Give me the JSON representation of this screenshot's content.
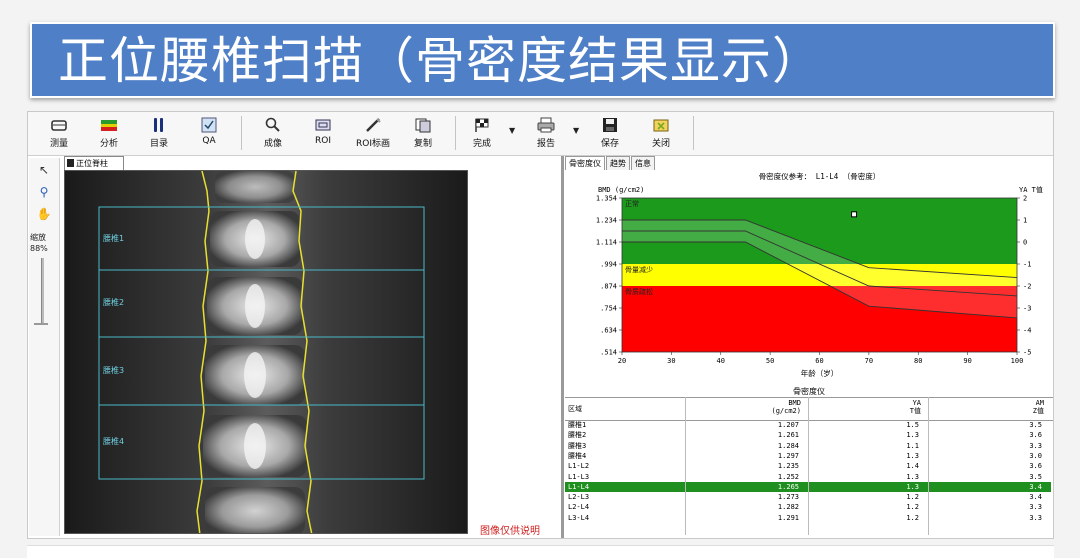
{
  "banner": {
    "title": "正位腰椎扫描（骨密度结果显示）"
  },
  "toolbar": {
    "buttons": [
      {
        "label": "测量",
        "icon": "measure-icon"
      },
      {
        "label": "分析",
        "icon": "analyze-icon"
      },
      {
        "label": "目录",
        "icon": "catalog-icon"
      },
      {
        "label": "QA",
        "icon": "qa-icon"
      },
      {
        "label": "成像",
        "icon": "imaging-icon"
      },
      {
        "label": "ROI",
        "icon": "roi-icon"
      },
      {
        "label": "ROI标画",
        "icon": "roi-draw-icon"
      },
      {
        "label": "复制",
        "icon": "copy-icon"
      },
      {
        "label": "完成",
        "icon": "finish-flag-icon"
      },
      {
        "label": "报告",
        "icon": "printer-icon"
      },
      {
        "label": "保存",
        "icon": "save-icon"
      },
      {
        "label": "关闭",
        "icon": "close-folder-icon"
      }
    ]
  },
  "left_tools": {
    "zoom_label": "缩放",
    "zoom_value": "88%"
  },
  "image_panel": {
    "tab": "正位脊柱",
    "vertebra_labels": [
      "腰椎1",
      "腰椎2",
      "腰椎3",
      "腰椎4"
    ],
    "caption": "图像仅供说明"
  },
  "right_panel": {
    "tabs": [
      "骨密度仪",
      "趋势",
      "信息"
    ],
    "table_title": "骨密度仪"
  },
  "chart_data": {
    "type": "line",
    "title": "骨密度仪参考： L1-L4 （骨密度）",
    "ylabel": "BMD (g/cm2)",
    "y2label": "YA T值",
    "xlabel": "年龄（岁）",
    "xlim": [
      20,
      100
    ],
    "ylim": [
      0.514,
      1.354
    ],
    "x_ticks": [
      "20",
      "30",
      "40",
      "50",
      "60",
      "70",
      "80",
      "90",
      "100"
    ],
    "y_ticks": [
      "1.354",
      "1.234",
      "1.114",
      ".994",
      ".874",
      ".754",
      ".634",
      ".514"
    ],
    "y2_ticks": [
      "2",
      "1",
      "0",
      "-1",
      "-2",
      "-3",
      "-4",
      "-5"
    ],
    "zones": [
      {
        "name": "正常",
        "from": 0.994,
        "to": 1.354,
        "color": "#1c9a1c"
      },
      {
        "name": "骨量减少",
        "from": 0.874,
        "to": 0.994,
        "color": "#ffff00"
      },
      {
        "name": "骨质疏松",
        "from": 0.514,
        "to": 0.874,
        "color": "#ff0000"
      }
    ],
    "series": [
      {
        "x": [
          20,
          45,
          70,
          100
        ],
        "values": [
          1.234,
          1.234,
          0.974,
          0.92
        ]
      },
      {
        "x": [
          20,
          45,
          70,
          100
        ],
        "values": [
          1.174,
          1.174,
          0.874,
          0.82
        ]
      },
      {
        "x": [
          20,
          45,
          70,
          100
        ],
        "values": [
          1.114,
          1.114,
          0.764,
          0.7
        ]
      }
    ],
    "point": {
      "x": 67,
      "y": 1.265
    }
  },
  "table": {
    "headers": {
      "region": "区域",
      "bmd": [
        "BMD",
        "(g/cm2)"
      ],
      "ya": [
        "YA",
        "T值"
      ],
      "am": [
        "AM",
        "Z值"
      ]
    },
    "rows": [
      {
        "region": "腰椎1",
        "bmd": "1.207",
        "t": "1.5",
        "z": "3.5"
      },
      {
        "region": "腰椎2",
        "bmd": "1.261",
        "t": "1.3",
        "z": "3.6"
      },
      {
        "region": "腰椎3",
        "bmd": "1.284",
        "t": "1.1",
        "z": "3.3"
      },
      {
        "region": "腰椎4",
        "bmd": "1.297",
        "t": "1.3",
        "z": "3.0"
      },
      {
        "region": "L1-L2",
        "bmd": "1.235",
        "t": "1.4",
        "z": "3.6"
      },
      {
        "region": "L1-L3",
        "bmd": "1.252",
        "t": "1.3",
        "z": "3.5"
      },
      {
        "region": "L1-L4",
        "bmd": "1.265",
        "t": "1.3",
        "z": "3.4",
        "highlight": true
      },
      {
        "region": "L2-L3",
        "bmd": "1.273",
        "t": "1.2",
        "z": "3.4"
      },
      {
        "region": "L2-L4",
        "bmd": "1.282",
        "t": "1.2",
        "z": "3.3"
      },
      {
        "region": "L3-L4",
        "bmd": "1.291",
        "t": "1.2",
        "z": "3.3"
      }
    ]
  }
}
